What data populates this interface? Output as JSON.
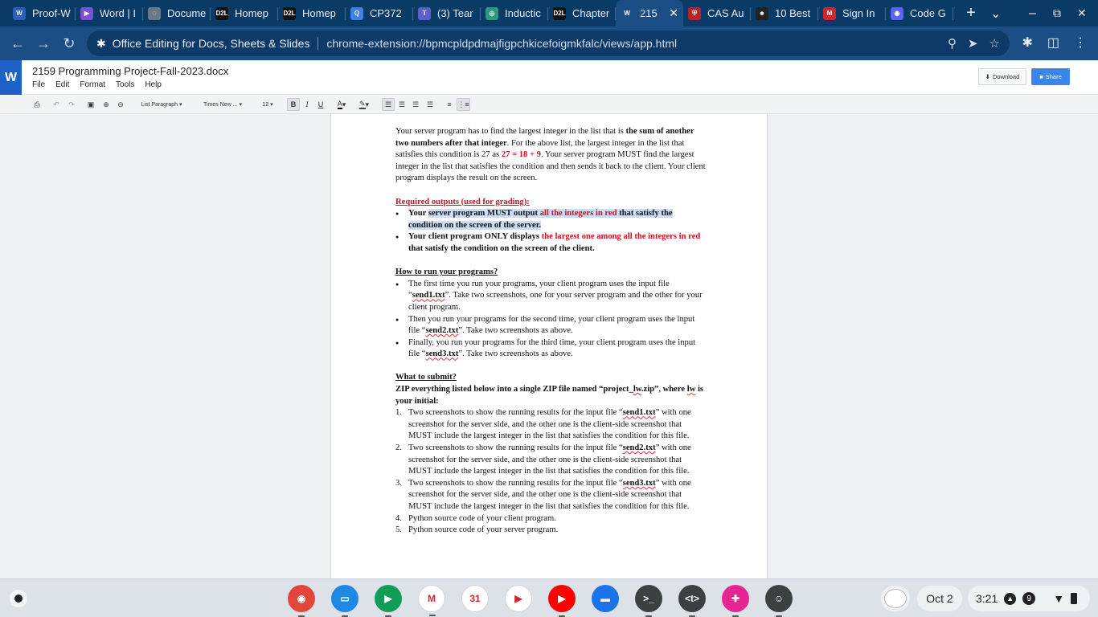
{
  "browser": {
    "tabs": [
      {
        "title": "Proof-W",
        "icon": "word-icon",
        "color": "#2b5fb8",
        "glyph": "W"
      },
      {
        "title": "Word | I",
        "icon": "copilot-icon",
        "color": "#7b4fd6",
        "glyph": "▶"
      },
      {
        "title": "Docume",
        "icon": "globe-icon",
        "color": "#6b7785",
        "glyph": "◌"
      },
      {
        "title": "Homep",
        "icon": "d2l-icon",
        "color": "#111111",
        "glyph": "D2L"
      },
      {
        "title": "Homep",
        "icon": "d2l-icon",
        "color": "#111111",
        "glyph": "D2L"
      },
      {
        "title": "CP372",
        "icon": "q-icon",
        "color": "#3f7fe8",
        "glyph": "Q"
      },
      {
        "title": "(3) Tear",
        "icon": "teams-icon",
        "color": "#5b5fc7",
        "glyph": "T"
      },
      {
        "title": "Inductic",
        "icon": "openai-icon",
        "color": "#2a9a7d",
        "glyph": "◎"
      },
      {
        "title": "Chapter",
        "icon": "d2l-icon",
        "color": "#111111",
        "glyph": "D2L"
      },
      {
        "title": "215",
        "icon": "word-w-icon",
        "color": "#1a4e85",
        "glyph": "W"
      },
      {
        "title": "CAS Au",
        "icon": "cas-icon",
        "color": "#b3262e",
        "glyph": "⛨"
      },
      {
        "title": "10 Best",
        "icon": "robot-icon",
        "color": "#222222",
        "glyph": "☻"
      },
      {
        "title": "Sign In",
        "icon": "m-icon",
        "color": "#d0262f",
        "glyph": "M"
      },
      {
        "title": "Code G",
        "icon": "discord-icon",
        "color": "#5865f2",
        "glyph": "◉"
      }
    ],
    "active_tab_index": 9,
    "new_tab": "+",
    "tab_search": "⌄",
    "window_controls": {
      "minimize": "–",
      "restore": "⧉",
      "close": "✕"
    },
    "omnibox": {
      "extension_name": "Office Editing for Docs, Sheets & Slides",
      "url": "chrome-extension://bpmcpldpdmajfigpchkicefoigmkfalc/views/app.html"
    }
  },
  "app": {
    "logo": "W",
    "doc_title": "2159 Programming Project-Fall-2023.docx",
    "menus": [
      "File",
      "Edit",
      "Format",
      "Tools",
      "Help"
    ],
    "download_label": "Download",
    "share_label": "Share",
    "toolbar": {
      "style": "List Paragraph",
      "font": "Times New ...",
      "size": "12",
      "bold": "B",
      "italic": "I",
      "underline": "U"
    }
  },
  "document": {
    "para1": [
      {
        "t": "Your server program has to find the largest integer in the list that is ",
        "s": ""
      },
      {
        "t": "the sum of another two numbers after that integer",
        "s": "b"
      },
      {
        "t": ". For the above list, the largest integer in the list that satisfies this condition is 27 as ",
        "s": ""
      },
      {
        "t": "27 = 18 + 9",
        "s": "b red"
      },
      {
        "t": ". Your server program MUST find the largest integer in the list that satisfies the condition and then sends it back to the client. Your client program displays the result on the screen.",
        "s": ""
      }
    ],
    "required_heading": "Required outputs (used for grading):",
    "required_items": [
      [
        {
          "t": "Your ",
          "s": "b"
        },
        {
          "t": "server program MUST output ",
          "s": "b hl"
        },
        {
          "t": "all the integers in red",
          "s": "b red hl"
        },
        {
          "t": " that satisfy the condition on the screen of the server.",
          "s": "b hl"
        }
      ],
      [
        {
          "t": "Your client program ONLY displays ",
          "s": "b"
        },
        {
          "t": "the largest one among all the integers in red",
          "s": "b red"
        },
        {
          "t": " that satisfy the condition on the screen of the client.",
          "s": "b"
        }
      ]
    ],
    "run_heading": "How to run your programs?",
    "run_items": [
      [
        {
          "t": "The first time you run your programs, your client program uses the input file “",
          "s": ""
        },
        {
          "t": "send1.txt",
          "s": "b sq"
        },
        {
          "t": "”. Take two screenshots, one for your server program and the other for your client program.",
          "s": ""
        }
      ],
      [
        {
          "t": "Then you run your programs for the second time, your client program uses the input file “",
          "s": ""
        },
        {
          "t": "send2.txt",
          "s": "b sq"
        },
        {
          "t": "”. Take two screenshots as above.",
          "s": ""
        }
      ],
      [
        {
          "t": "Finally, you run your programs for the third time, your client program uses the input file “",
          "s": ""
        },
        {
          "t": "send3.txt",
          "s": "b sq"
        },
        {
          "t": "”. Take two screenshots as above.",
          "s": ""
        }
      ]
    ],
    "submit_heading": "What to submit?",
    "submit_intro": [
      {
        "t": "ZIP everything listed below into a single ZIP file named “project_",
        "s": "b"
      },
      {
        "t": "lw",
        "s": "b sq"
      },
      {
        "t": ".zip”, where ",
        "s": "b"
      },
      {
        "t": "lw",
        "s": "b sq"
      },
      {
        "t": " is your initial:",
        "s": "b"
      }
    ],
    "submit_items": [
      [
        {
          "t": "Two screenshots to show the running results for the input file “",
          "s": ""
        },
        {
          "t": "send1.txt",
          "s": "b sq"
        },
        {
          "t": "” with one screenshot for the server side, and the other one is the client-side screenshot that MUST include the largest integer in the list that satisfies the condition for this file.",
          "s": ""
        }
      ],
      [
        {
          "t": "Two screenshots to show the running results for the input file “",
          "s": ""
        },
        {
          "t": "send2.txt",
          "s": "b sq"
        },
        {
          "t": "” with one screenshot for the server side, and the other one is the client-side screenshot that MUST include the largest integer in the list that satisfies the condition for this file.",
          "s": ""
        }
      ],
      [
        {
          "t": "Two screenshots to show the running results for the input file “",
          "s": ""
        },
        {
          "t": "send3.txt",
          "s": "b sq"
        },
        {
          "t": "” with one screenshot for the server side, and the other one is the client-side screenshot that MUST include the largest integer in the list that satisfies the condition for this file.",
          "s": ""
        }
      ],
      [
        {
          "t": "Python source code of your client program.",
          "s": ""
        }
      ],
      [
        {
          "t": "Python source code of your server program.",
          "s": ""
        }
      ]
    ]
  },
  "shelf": {
    "apps": [
      {
        "name": "chrome-icon",
        "color": "#e0463a",
        "glyph": "◉"
      },
      {
        "name": "files-icon",
        "color": "#1e88e5",
        "glyph": "▭"
      },
      {
        "name": "meet-icon",
        "color": "#0f9d58",
        "glyph": "▶"
      },
      {
        "name": "gmail-icon",
        "color": "#ffffff",
        "glyph": "M"
      },
      {
        "name": "calendar-icon",
        "color": "#ffffff",
        "glyph": "31"
      },
      {
        "name": "play-store-icon",
        "color": "#ffffff",
        "glyph": "▶"
      },
      {
        "name": "youtube-icon",
        "color": "#ff0000",
        "glyph": "▶"
      },
      {
        "name": "chat-icon",
        "color": "#1a73e8",
        "glyph": "▬"
      },
      {
        "name": "terminal-icon",
        "color": "#3c4043",
        "glyph": ">_"
      },
      {
        "name": "dev-tool-icon",
        "color": "#3c4043",
        "glyph": "<t>"
      },
      {
        "name": "screencast-icon",
        "color": "#e52592",
        "glyph": "✚"
      },
      {
        "name": "linux-penguin-icon",
        "color": "#3c4043",
        "glyph": "☺"
      }
    ],
    "date": "Oct 2",
    "time": "3:21",
    "notifications": "9"
  }
}
